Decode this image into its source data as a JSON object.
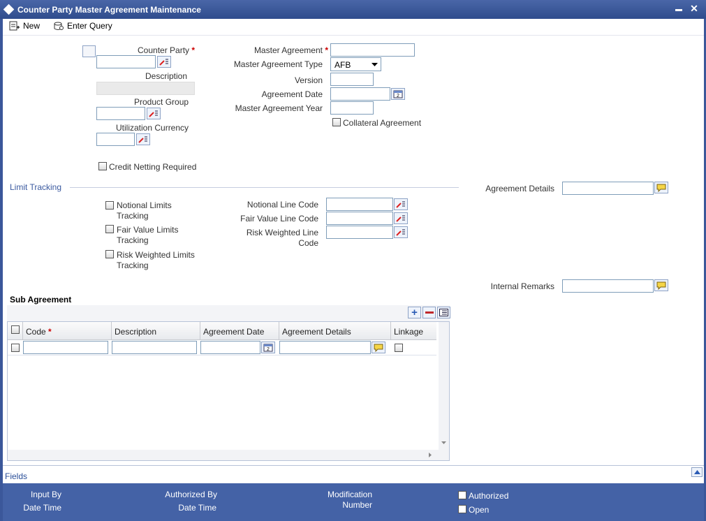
{
  "window": {
    "title": "Counter Party Master Agreement Maintenance",
    "minimize": "▬",
    "close": "✕"
  },
  "toolbar": {
    "new_label": "New",
    "enter_query_label": "Enter Query"
  },
  "header": {
    "counter_party_label": "Counter Party",
    "description_label": "Description",
    "product_group_label": "Product Group",
    "utilization_currency_label": "Utilization Currency",
    "credit_netting_label": "Credit Netting Required",
    "master_agreement_label": "Master Agreement",
    "master_agreement_type_label": "Master Agreement Type",
    "master_agreement_type_value": "AFB",
    "version_label": "Version",
    "agreement_date_label": "Agreement Date",
    "master_agreement_year_label": "Master Agreement Year",
    "collateral_agreement_label": "Collateral Agreement",
    "required_mark": "*"
  },
  "limit_tracking": {
    "section_label": "Limit Tracking",
    "notional_tracking": "Notional Limits Tracking",
    "fair_value_tracking": "Fair Value Limits Tracking",
    "risk_weighted_tracking": "Risk Weighted Limits Tracking",
    "notional_line_code_label": "Notional Line Code",
    "fair_value_line_code_label": "Fair Value Line Code",
    "risk_weighted_line_code_label": "Risk Weighted Line Code",
    "agreement_details_label": "Agreement Details",
    "internal_remarks_label": "Internal Remarks"
  },
  "sub_agreement": {
    "section_label": "Sub Agreement",
    "columns": [
      "Code",
      "Description",
      "Agreement Date",
      "Agreement Details",
      "Linkage"
    ]
  },
  "footer": {
    "fields_label": "Fields",
    "input_by": "Input By",
    "date_time_1": "Date Time",
    "authorized_by": "Authorized By",
    "date_time_2": "Date Time",
    "modification": "Modification",
    "number": "Number",
    "authorized": "Authorized",
    "open": "Open"
  },
  "colors": {
    "titlebar": "#2f4c8d",
    "footer": "#4462a6",
    "section": "#3b5aa0",
    "required": "#cc0000"
  }
}
